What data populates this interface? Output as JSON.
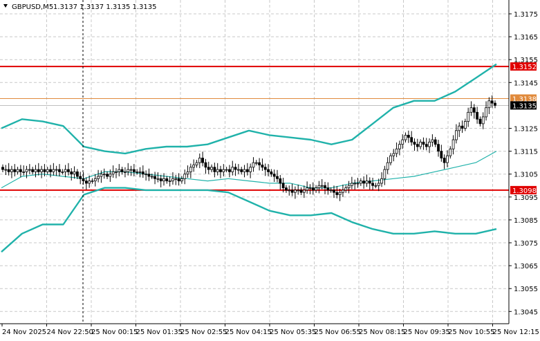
{
  "header": {
    "symbol": "GBPUSD,M5",
    "ohlc": "1.3137 1.3137 1.3135 1.3135"
  },
  "colors": {
    "background": "#ffffff",
    "grid": "#c8c8c8",
    "axis": "#000000",
    "candle": "#000000",
    "bollinger": "#20b2aa",
    "support_resistance": "#e00000",
    "ask_line": "#e08a3c",
    "bid_line": "#999999",
    "crosshair": "#000000"
  },
  "chart_data": {
    "type": "candlestick",
    "title": "GBPUSD,M5",
    "ylim": [
      1.304,
      1.318
    ],
    "y_ticks": [
      "1.3175",
      "1.3165",
      "1.3155",
      "1.3145",
      "1.3125",
      "1.3115",
      "1.3105",
      "1.3095",
      "1.3085",
      "1.3075",
      "1.3065",
      "1.3055",
      "1.3045"
    ],
    "x_tick_labels": [
      "24 Nov 2025",
      "24 Nov 22:50",
      "25 Nov 00:15",
      "25 Nov 01:35",
      "25 Nov 02:55",
      "25 Nov 04:15",
      "25 Nov 05:35",
      "25 Nov 06:55",
      "25 Nov 08:15",
      "25 Nov 09:35",
      "25 Nov 10:55",
      "25 Nov 12:15"
    ],
    "grid": true,
    "horizontal_levels": [
      {
        "label": "1.3152",
        "value": 1.3152,
        "role": "resistance"
      },
      {
        "label": "1.3138",
        "value": 1.3138,
        "role": "ask"
      },
      {
        "label": "1.3135",
        "value": 1.3135,
        "role": "bid"
      },
      {
        "label": "1.3098",
        "value": 1.3098,
        "role": "support"
      }
    ],
    "candles_close": [
      1.3107,
      1.3107,
      1.3106,
      1.3107,
      1.3106,
      1.3107,
      1.3106,
      1.3106,
      1.3107,
      1.3107,
      1.3106,
      1.3107,
      1.3106,
      1.3107,
      1.3106,
      1.3107,
      1.3106,
      1.3107,
      1.3107,
      1.3106,
      1.3106,
      1.3107,
      1.3106,
      1.3105,
      1.3106,
      1.3104,
      1.3103,
      1.3102,
      1.3101,
      1.3102,
      1.3102,
      1.3103,
      1.3104,
      1.3105,
      1.3105,
      1.3104,
      1.3105,
      1.3106,
      1.3106,
      1.3107,
      1.3106,
      1.3106,
      1.3107,
      1.3107,
      1.3106,
      1.3106,
      1.3106,
      1.3105,
      1.3105,
      1.3104,
      1.3104,
      1.3103,
      1.3103,
      1.3102,
      1.3103,
      1.3102,
      1.3102,
      1.3103,
      1.3103,
      1.3102,
      1.3103,
      1.3105,
      1.3106,
      1.3108,
      1.3109,
      1.311,
      1.3112,
      1.311,
      1.3108,
      1.3107,
      1.3108,
      1.3106,
      1.3107,
      1.3106,
      1.3107,
      1.3107,
      1.3106,
      1.3108,
      1.3107,
      1.3107,
      1.3106,
      1.3107,
      1.3106,
      1.3108,
      1.311,
      1.311,
      1.3109,
      1.3108,
      1.3107,
      1.3106,
      1.3105,
      1.3104,
      1.3103,
      1.3101,
      1.3099,
      1.3098,
      1.3098,
      1.3097,
      1.3098,
      1.3098,
      1.3097,
      1.3098,
      1.3099,
      1.3099,
      1.3098,
      1.3099,
      1.31,
      1.31,
      1.3099,
      1.3098,
      1.3098,
      1.3097,
      1.3096,
      1.3097,
      1.3098,
      1.3099,
      1.31,
      1.3101,
      1.3101,
      1.3101,
      1.3102,
      1.3101,
      1.3102,
      1.3101,
      1.31,
      1.31,
      1.3101,
      1.3103,
      1.3107,
      1.311,
      1.3113,
      1.3114,
      1.3116,
      1.3118,
      1.312,
      1.3122,
      1.3121,
      1.3119,
      1.3118,
      1.3117,
      1.3119,
      1.3118,
      1.3117,
      1.3119,
      1.312,
      1.3118,
      1.3115,
      1.3112,
      1.311,
      1.3113,
      1.3116,
      1.312,
      1.3124,
      1.3126,
      1.3125,
      1.3128,
      1.3132,
      1.3134,
      1.3132,
      1.3129,
      1.3127,
      1.313,
      1.3134,
      1.3137,
      1.3136,
      1.3135
    ],
    "series": [
      {
        "values": [
          1.3125,
          1.3129,
          1.3128,
          1.3126,
          1.3117,
          1.3115,
          1.3114,
          1.3116,
          1.3117,
          1.3117,
          1.3118,
          1.3121,
          1.3124,
          1.3122,
          1.3121,
          1.312,
          1.3118,
          1.312,
          1.3127,
          1.3134,
          1.3137,
          1.3137,
          1.3141,
          1.3147,
          1.3153
        ]
      },
      {
        "values": [
          1.3099,
          1.3104,
          1.3105,
          1.3104,
          1.3103,
          1.3106,
          1.3106,
          1.3105,
          1.3104,
          1.3103,
          1.3102,
          1.3103,
          1.3102,
          1.3101,
          1.3101,
          1.3099,
          1.3099,
          1.3101,
          1.3102,
          1.3103,
          1.3104,
          1.3106,
          1.3108,
          1.311,
          1.3115
        ]
      },
      {
        "values": [
          1.3071,
          1.3079,
          1.3083,
          1.3083,
          1.3096,
          1.3099,
          1.3099,
          1.3098,
          1.3098,
          1.3098,
          1.3098,
          1.3097,
          1.3093,
          1.3089,
          1.3087,
          1.3087,
          1.3088,
          1.3084,
          1.3081,
          1.3079,
          1.3079,
          1.308,
          1.3079,
          1.3079,
          1.3081
        ]
      }
    ]
  }
}
